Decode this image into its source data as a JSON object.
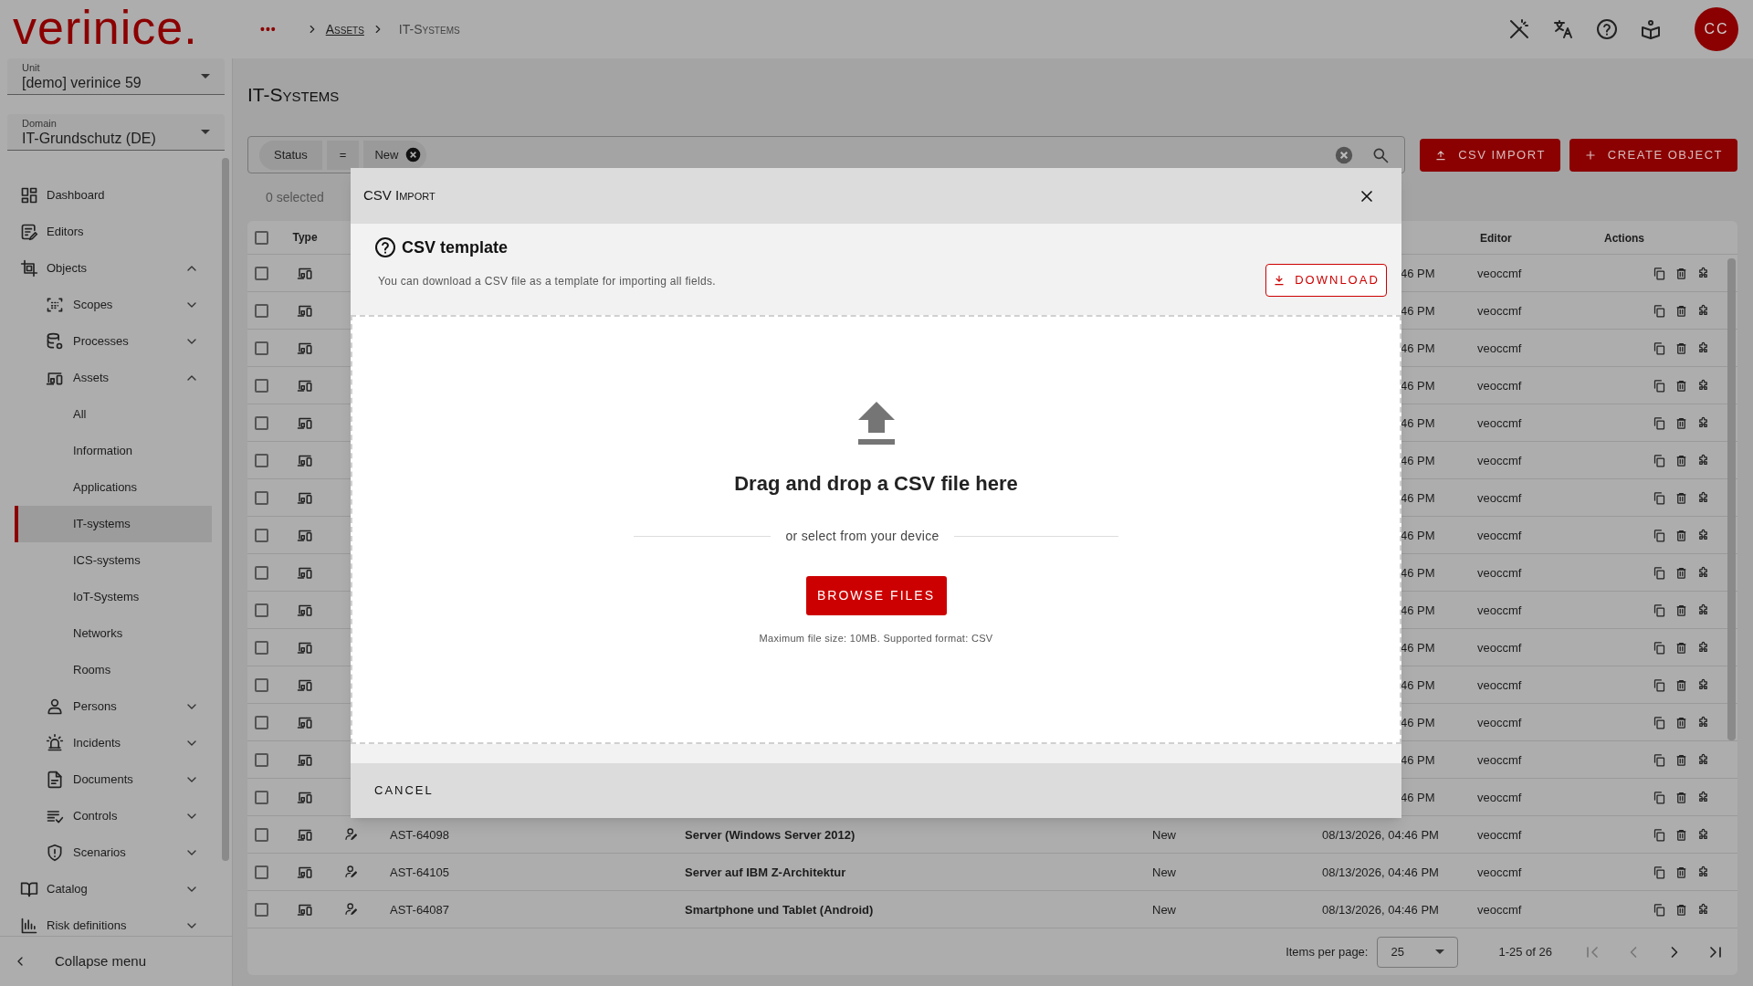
{
  "header": {
    "logo": "verinice.",
    "breadcrumbs": [
      {
        "kind": "more",
        "label": "•••"
      },
      {
        "kind": "link",
        "label": "Assets"
      },
      {
        "kind": "current",
        "label": "IT-Systems"
      }
    ],
    "avatar": "CC"
  },
  "sidebar": {
    "selects": [
      {
        "label": "Unit",
        "value": "[demo] verinice 59"
      },
      {
        "label": "Domain",
        "value": "IT-Grundschutz (DE)"
      }
    ],
    "items": [
      {
        "label": "Dashboard",
        "selected": false
      },
      {
        "label": "Editors",
        "selected": false
      },
      {
        "label": "Objects",
        "selected": false,
        "expanded": true,
        "children": [
          {
            "label": "Scopes",
            "selected": false,
            "expanded": false
          },
          {
            "label": "Processes",
            "selected": false,
            "expanded": false
          },
          {
            "label": "Assets",
            "selected": false,
            "expanded": true,
            "children": [
              {
                "label": "All",
                "selected": false
              },
              {
                "label": "Information",
                "selected": false
              },
              {
                "label": "Applications",
                "selected": false
              },
              {
                "label": "IT-systems",
                "selected": true
              },
              {
                "label": "ICS-systems",
                "selected": false
              },
              {
                "label": "IoT-Systems",
                "selected": false
              },
              {
                "label": "Networks",
                "selected": false
              },
              {
                "label": "Rooms",
                "selected": false
              }
            ]
          },
          {
            "label": "Persons",
            "selected": false,
            "expanded": false
          },
          {
            "label": "Incidents",
            "selected": false,
            "expanded": false
          },
          {
            "label": "Documents",
            "selected": false,
            "expanded": false
          },
          {
            "label": "Controls",
            "selected": false,
            "expanded": false
          },
          {
            "label": "Scenarios",
            "selected": false,
            "expanded": false
          }
        ]
      },
      {
        "label": "Catalog",
        "selected": false,
        "expanded": false
      },
      {
        "label": "Risk definitions",
        "selected": false,
        "expanded": false
      }
    ],
    "collapse": "Collapse menu"
  },
  "page": {
    "title": "IT-Systems",
    "filter": {
      "chips": [
        {
          "kind": "field",
          "label": "Status"
        },
        {
          "kind": "operator",
          "label": "="
        },
        {
          "kind": "value",
          "label": "New"
        }
      ]
    },
    "buttons": [
      {
        "kind": "import",
        "label": "CSV IMPORT"
      },
      {
        "kind": "create",
        "label": "CREATE OBJECT"
      }
    ],
    "selected_count": "0 selected"
  },
  "table": {
    "header": {
      "checked": false,
      "type": "Type",
      "editor": "Editor",
      "actions": "Actions"
    },
    "rows": [
      {
        "kind": "covered",
        "checked": false,
        "updated": "46 PM",
        "editor": "veoccmf"
      },
      {
        "kind": "covered",
        "checked": false,
        "updated": "46 PM",
        "editor": "veoccmf"
      },
      {
        "kind": "covered",
        "checked": false,
        "updated": "46 PM",
        "editor": "veoccmf"
      },
      {
        "kind": "covered",
        "checked": false,
        "updated": "46 PM",
        "editor": "veoccmf"
      },
      {
        "kind": "covered",
        "checked": false,
        "updated": "46 PM",
        "editor": "veoccmf"
      },
      {
        "kind": "covered",
        "checked": false,
        "updated": "46 PM",
        "editor": "veoccmf"
      },
      {
        "kind": "covered",
        "checked": false,
        "updated": "46 PM",
        "editor": "veoccmf"
      },
      {
        "kind": "covered",
        "checked": false,
        "updated": "46 PM",
        "editor": "veoccmf"
      },
      {
        "kind": "covered",
        "checked": false,
        "updated": "46 PM",
        "editor": "veoccmf"
      },
      {
        "kind": "covered",
        "checked": false,
        "updated": "46 PM",
        "editor": "veoccmf"
      },
      {
        "kind": "covered",
        "checked": false,
        "updated": "46 PM",
        "editor": "veoccmf"
      },
      {
        "kind": "covered",
        "checked": false,
        "updated": "46 PM",
        "editor": "veoccmf"
      },
      {
        "kind": "covered",
        "checked": false,
        "updated": "46 PM",
        "editor": "veoccmf"
      },
      {
        "kind": "covered",
        "checked": false,
        "updated": "46 PM",
        "editor": "veoccmf"
      },
      {
        "kind": "covered",
        "checked": false,
        "updated": "46 PM",
        "editor": "veoccmf"
      },
      {
        "kind": "full",
        "checked": false,
        "abbreviation": "AST-64098",
        "name": "Server (Windows Server 2012)",
        "status": "New",
        "updated": "08/13/2026, 04:46 PM",
        "editor": "veoccmf"
      },
      {
        "kind": "full",
        "checked": false,
        "abbreviation": "AST-64105",
        "name": "Server auf IBM Z-Architektur",
        "status": "New",
        "updated": "08/13/2026, 04:46 PM",
        "editor": "veoccmf"
      },
      {
        "kind": "full",
        "checked": false,
        "abbreviation": "AST-64087",
        "name": "Smartphone und Tablet (Android)",
        "status": "New",
        "updated": "08/13/2026, 04:46 PM",
        "editor": "veoccmf"
      }
    ],
    "pagination": {
      "label": "Items per page:",
      "page_size": "25",
      "range": "1-25 of 26"
    }
  },
  "dialog": {
    "title": "CSV Import",
    "template_title": "CSV template",
    "template_text": "You can download a CSV file as a template for importing all fields.",
    "download": "DOWNLOAD",
    "drop_title": "Drag and drop a CSV file here",
    "divider_text": "or select from your device",
    "browse": "BROWSE FILES",
    "note": "Maximum file size: 10MB. Supported format: CSV",
    "cancel": "CANCEL"
  }
}
